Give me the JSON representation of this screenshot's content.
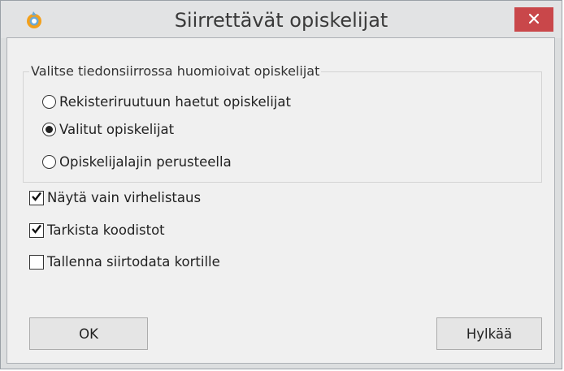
{
  "window": {
    "title": "Siirrettävät opiskelijat",
    "icon": "app-logo-icon",
    "close_icon": "close-icon"
  },
  "group": {
    "legend": "Valitse tiedonsiirrossa huomioivat opiskelijat",
    "options": [
      {
        "label": "Rekisteriruutuun haetut opiskelijat",
        "selected": false
      },
      {
        "label": "Valitut opiskelijat",
        "selected": true
      },
      {
        "label": "Opiskelijalajin perusteella",
        "selected": false
      }
    ]
  },
  "checkboxes": [
    {
      "label": "Näytä vain virhelistaus",
      "checked": true
    },
    {
      "label": "Tarkista koodistot",
      "checked": true
    },
    {
      "label": "Tallenna siirtodata kortille",
      "checked": false
    }
  ],
  "buttons": {
    "ok": "OK",
    "cancel": "Hylkää"
  },
  "colors": {
    "close_button": "#c9474a",
    "dialog_bg": "#f0f0f0"
  }
}
